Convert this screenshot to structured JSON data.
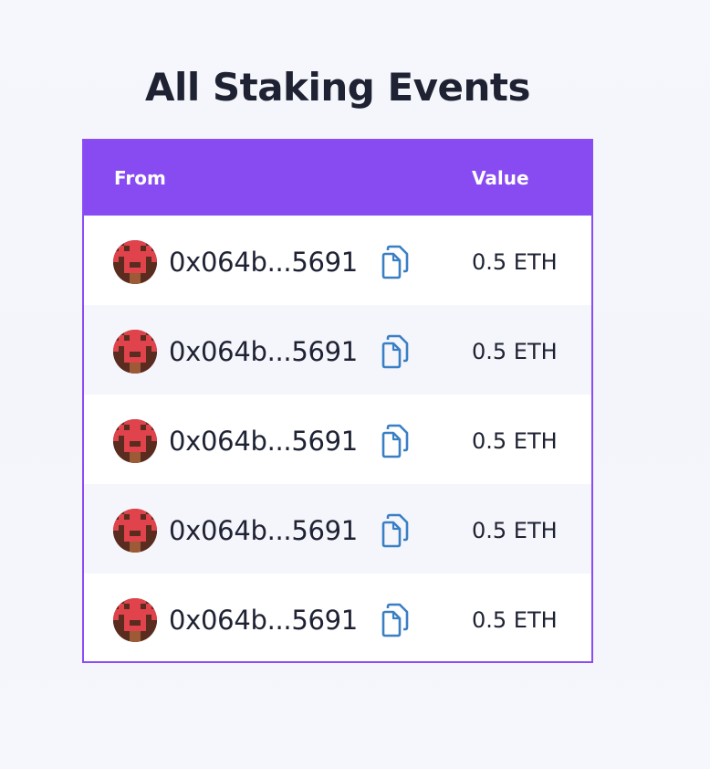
{
  "page": {
    "title": "All Staking Events"
  },
  "table": {
    "columns": {
      "from": "From",
      "value": "Value"
    },
    "rows": [
      {
        "address": "0x064b...5691",
        "value": "0.5 ETH",
        "avatar_icon": "pixel-avatar-icon",
        "copy_icon": "copy-icon"
      },
      {
        "address": "0x064b...5691",
        "value": "0.5 ETH",
        "avatar_icon": "pixel-avatar-icon",
        "copy_icon": "copy-icon"
      },
      {
        "address": "0x064b...5691",
        "value": "0.5 ETH",
        "avatar_icon": "pixel-avatar-icon",
        "copy_icon": "copy-icon"
      },
      {
        "address": "0x064b...5691",
        "value": "0.5 ETH",
        "avatar_icon": "pixel-avatar-icon",
        "copy_icon": "copy-icon"
      },
      {
        "address": "0x064b...5691",
        "value": "0.5 ETH",
        "avatar_icon": "pixel-avatar-icon",
        "copy_icon": "copy-icon"
      }
    ]
  },
  "colors": {
    "header_bg": "#884bf2",
    "table_border": "#8a4cf4",
    "title_text": "#1e2233",
    "copy_icon": "#3a7fc4",
    "avatar_dark": "#5a2b1f",
    "avatar_red": "#e0434c"
  }
}
